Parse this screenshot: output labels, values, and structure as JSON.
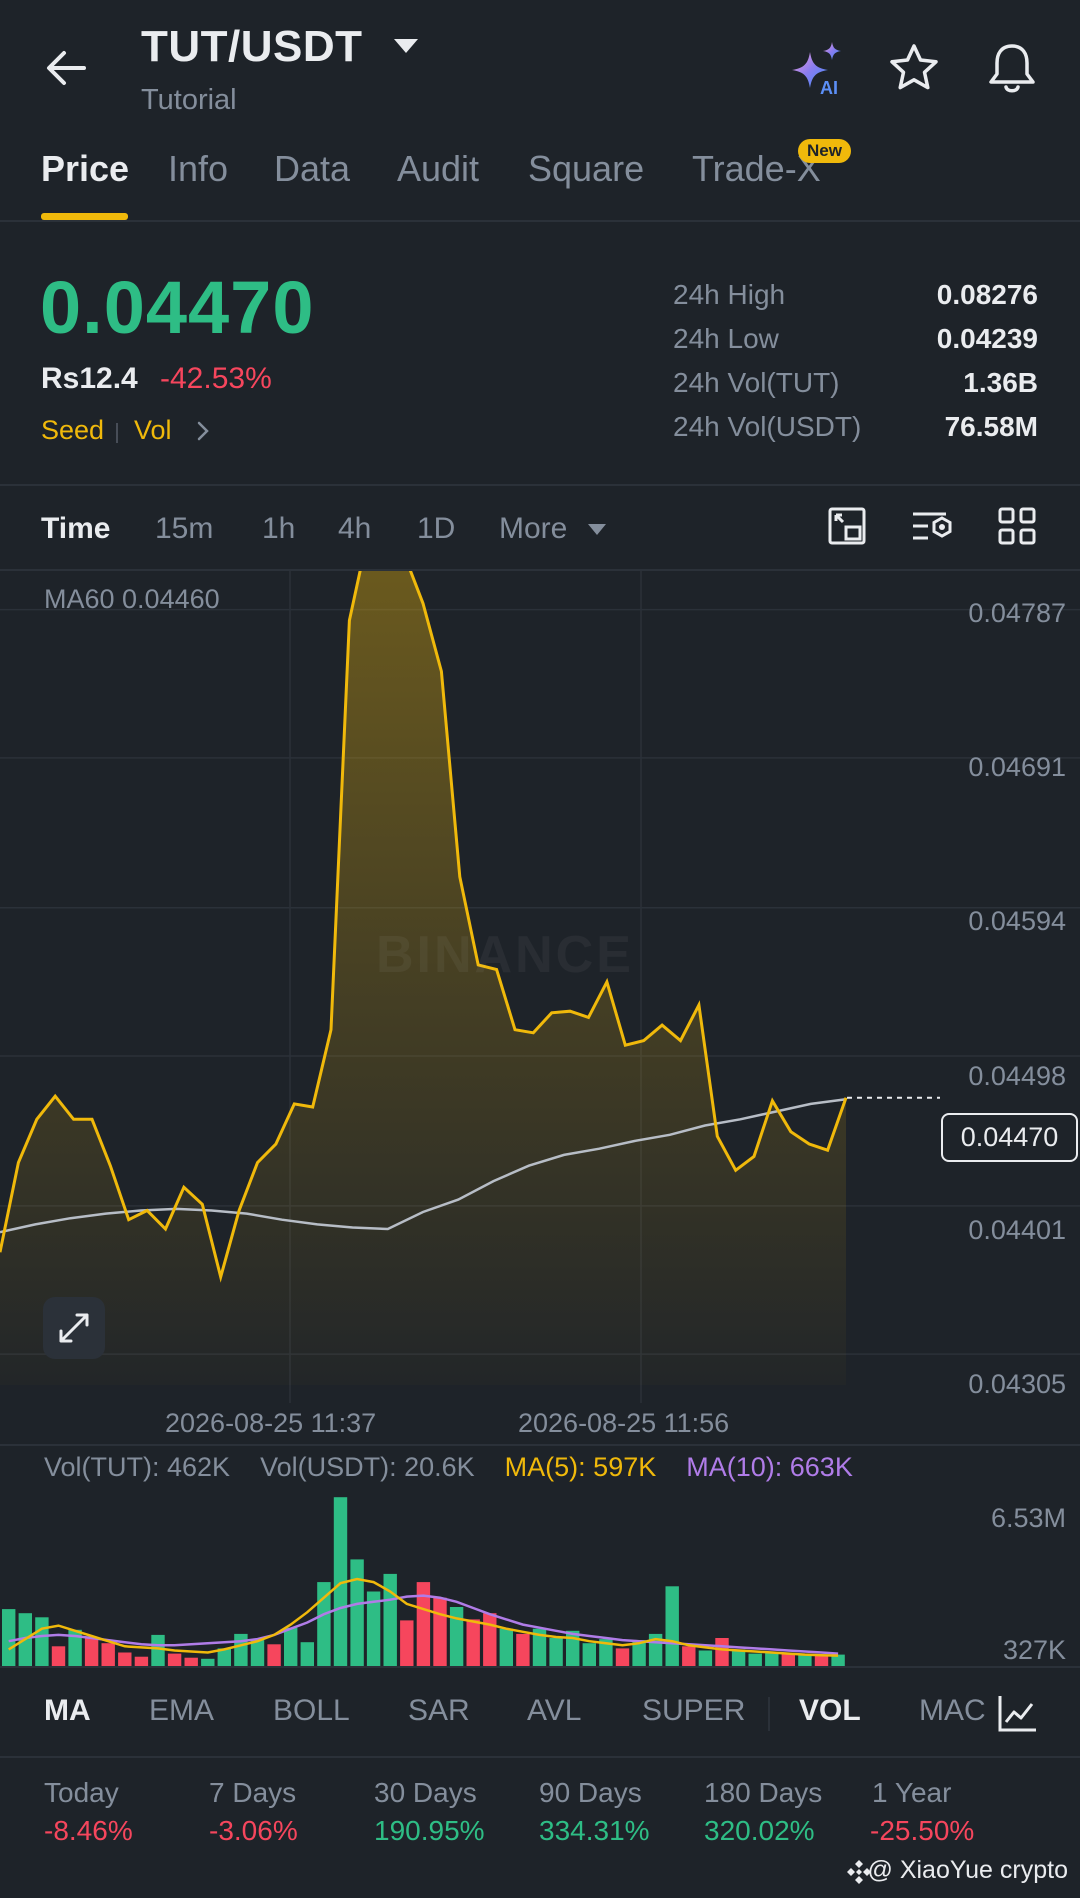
{
  "header": {
    "title": "TUT/USDT",
    "subtitle": "Tutorial",
    "icons": [
      "back-arrow-icon",
      "caret-down-icon",
      "ai-sparkle-icon",
      "star-icon",
      "bell-icon"
    ]
  },
  "tabs": [
    {
      "label": "Price",
      "active": true
    },
    {
      "label": "Info"
    },
    {
      "label": "Data"
    },
    {
      "label": "Audit"
    },
    {
      "label": "Square"
    },
    {
      "label": "Trade-X",
      "badge": "New"
    }
  ],
  "price": {
    "last": "0.04470",
    "fiat": "Rs12.4",
    "change": "-42.53%",
    "tags": [
      "Seed",
      "Vol"
    ]
  },
  "stats": [
    {
      "label": "24h High",
      "value": "0.08276"
    },
    {
      "label": "24h Low",
      "value": "0.04239"
    },
    {
      "label": "24h Vol(TUT)",
      "value": "1.36B"
    },
    {
      "label": "24h Vol(USDT)",
      "value": "76.58M"
    }
  ],
  "intervals": [
    "Time",
    "15m",
    "1h",
    "4h",
    "1D",
    "More"
  ],
  "chart": {
    "ma60_label": "MA60 0.04460",
    "current_price_tag": "0.04470",
    "watermark": "BINANCE",
    "colors": {
      "line": "#f0b90b",
      "ma": "#b7bdc6",
      "up": "#2ebd85",
      "down": "#f6465d",
      "ma5": "#f0b90b",
      "ma10": "#b07ce8"
    }
  },
  "volume": {
    "vol_tut": "Vol(TUT): 462K",
    "vol_usdt": "Vol(USDT): 20.6K",
    "ma5": "MA(5): 597K",
    "ma10": "MA(10): 663K"
  },
  "indicators": [
    "MA",
    "EMA",
    "BOLL",
    "SAR",
    "AVL",
    "SUPER",
    "VOL",
    "MAC"
  ],
  "performance": [
    {
      "label": "Today",
      "value": "-8.46%"
    },
    {
      "label": "7 Days",
      "value": "-3.06%"
    },
    {
      "label": "30 Days",
      "value": "190.95%"
    },
    {
      "label": "90 Days",
      "value": "334.31%"
    },
    {
      "label": "180 Days",
      "value": "320.02%"
    },
    {
      "label": "1 Year",
      "value": "-25.50%"
    }
  ],
  "credit": "@ XiaoYue crypto",
  "chart_data": [
    {
      "type": "area",
      "title": "",
      "xlabel": "",
      "ylabel": "",
      "x_ticks": [
        "2026-08-25 11:37",
        "2026-08-25 11:56"
      ],
      "y_ticks": [
        "0.04787",
        "0.04691",
        "0.04594",
        "0.04498",
        "0.04401",
        "0.04305"
      ],
      "ylim": [
        0.04285,
        0.04812
      ],
      "series": [
        {
          "name": "",
          "values": [
            0.04371,
            0.04429,
            0.04457,
            0.04472,
            0.04457,
            0.04457,
            0.04427,
            0.04392,
            0.04398,
            0.04386,
            0.04413,
            0.04402,
            0.04355,
            0.04398,
            0.04429,
            0.04441,
            0.04467,
            0.04465,
            0.04515,
            0.0478,
            0.04835,
            0.04839,
            0.04822,
            0.04791,
            0.04747,
            0.04614,
            0.04557,
            0.04554,
            0.04515,
            0.04513,
            0.04526,
            0.04527,
            0.04523,
            0.04546,
            0.04505,
            0.04508,
            0.04518,
            0.04508,
            0.04531,
            0.04446,
            0.04424,
            0.04433,
            0.04469,
            0.04449,
            0.04441,
            0.04437,
            0.04471
          ]
        },
        {
          "name": "MA60",
          "values": [
            0.04384,
            0.04389,
            0.04393,
            0.04396,
            0.04398,
            0.04399,
            0.04398,
            0.04396,
            0.04392,
            0.04389,
            0.04387,
            0.04386,
            0.04397,
            0.04405,
            0.04417,
            0.04427,
            0.04434,
            0.04438,
            0.04443,
            0.04447,
            0.04453,
            0.04457,
            0.04462,
            0.04467,
            0.0447
          ]
        }
      ]
    },
    {
      "type": "bar",
      "title": "",
      "y_ticks": [
        "6.53M",
        "327K"
      ],
      "series": [
        {
          "name": "Vol(TUT)",
          "values": [
            2.75,
            2.55,
            2.35,
            0.95,
            1.75,
            1.35,
            1.1,
            0.65,
            0.45,
            1.5,
            0.6,
            0.4,
            0.35,
            0.85,
            1.55,
            1.25,
            1.05,
            1.85,
            1.15,
            4.05,
            8.15,
            5.15,
            3.6,
            4.45,
            2.2,
            4.05,
            3.3,
            2.85,
            2.25,
            2.55,
            1.8,
            1.55,
            1.8,
            1.35,
            1.7,
            1.1,
            1.3,
            0.85,
            1.25,
            1.55,
            3.85,
            0.95,
            0.75,
            1.35,
            0.8,
            0.6,
            0.65,
            0.6,
            0.55,
            0.5,
            0.55
          ],
          "direction": [
            "up",
            "up",
            "up",
            "down",
            "up",
            "down",
            "down",
            "down",
            "down",
            "up",
            "down",
            "down",
            "up",
            "up",
            "up",
            "up",
            "down",
            "up",
            "up",
            "up",
            "up",
            "up",
            "up",
            "up",
            "down",
            "down",
            "down",
            "up",
            "down",
            "down",
            "up",
            "down",
            "up",
            "up",
            "up",
            "up",
            "up",
            "down",
            "up",
            "up",
            "up",
            "down",
            "up",
            "down",
            "up",
            "up",
            "up",
            "down",
            "up",
            "down",
            "up"
          ]
        },
        {
          "name": "MA(5)",
          "values": [
            0.8,
            1.3,
            1.8,
            1.95,
            1.7,
            1.45,
            1.2,
            0.95,
            0.9,
            0.85,
            0.75,
            0.7,
            0.65,
            0.8,
            1.0,
            1.2,
            1.5,
            2.0,
            2.6,
            3.3,
            4.0,
            4.2,
            4.05,
            3.6,
            3.0,
            2.75,
            2.5,
            2.3,
            2.15,
            2.0,
            1.8,
            1.65,
            1.5,
            1.4,
            1.35,
            1.2,
            1.1,
            1.0,
            1.1,
            1.3,
            1.2,
            1.0,
            0.9,
            0.8,
            0.75,
            0.7,
            0.65,
            0.6,
            0.55,
            0.52,
            0.5
          ]
        },
        {
          "name": "MA(10)",
          "values": [
            1.2,
            1.35,
            1.45,
            1.5,
            1.45,
            1.35,
            1.25,
            1.15,
            1.05,
            1.0,
            1.0,
            1.05,
            1.1,
            1.15,
            1.2,
            1.3,
            1.5,
            1.8,
            2.1,
            2.5,
            2.8,
            3.0,
            3.1,
            3.2,
            3.35,
            3.4,
            3.3,
            3.1,
            2.8,
            2.5,
            2.25,
            2.0,
            1.85,
            1.7,
            1.55,
            1.45,
            1.35,
            1.25,
            1.2,
            1.15,
            1.1,
            1.05,
            1.0,
            0.95,
            0.9,
            0.85,
            0.8,
            0.75,
            0.7,
            0.65,
            0.6
          ]
        }
      ]
    }
  ]
}
